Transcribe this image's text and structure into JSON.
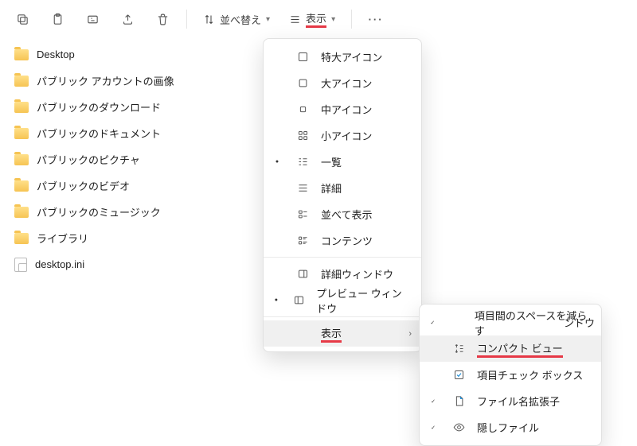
{
  "toolbar": {
    "sort_label": "並べ替え",
    "view_label": "表示"
  },
  "files": [
    {
      "name": "Desktop",
      "type": "folder"
    },
    {
      "name": "パブリック アカウントの画像",
      "type": "folder"
    },
    {
      "name": "パブリックのダウンロード",
      "type": "folder"
    },
    {
      "name": "パブリックのドキュメント",
      "type": "folder"
    },
    {
      "name": "パブリックのピクチャ",
      "type": "folder"
    },
    {
      "name": "パブリックのビデオ",
      "type": "folder"
    },
    {
      "name": "パブリックのミュージック",
      "type": "folder"
    },
    {
      "name": "ライブラリ",
      "type": "folder"
    },
    {
      "name": "desktop.ini",
      "type": "ini"
    }
  ],
  "view_menu": {
    "extra_large": "特大アイコン",
    "large": "大アイコン",
    "medium": "中アイコン",
    "small": "小アイコン",
    "list": "一覧",
    "details": "詳細",
    "tiles": "並べて表示",
    "content": "コンテンツ",
    "details_pane": "詳細ウィンドウ",
    "preview_pane": "プレビュー ウィンドウ",
    "show": "表示"
  },
  "show_menu": {
    "item_spacing": "項目間のスペースを減らす",
    "partial_hidden": "ンドウ",
    "compact_view": "コンパクト ビュー",
    "item_checkboxes": "項目チェック ボックス",
    "extensions": "ファイル名拡張子",
    "hidden_files": "隠しファイル"
  }
}
